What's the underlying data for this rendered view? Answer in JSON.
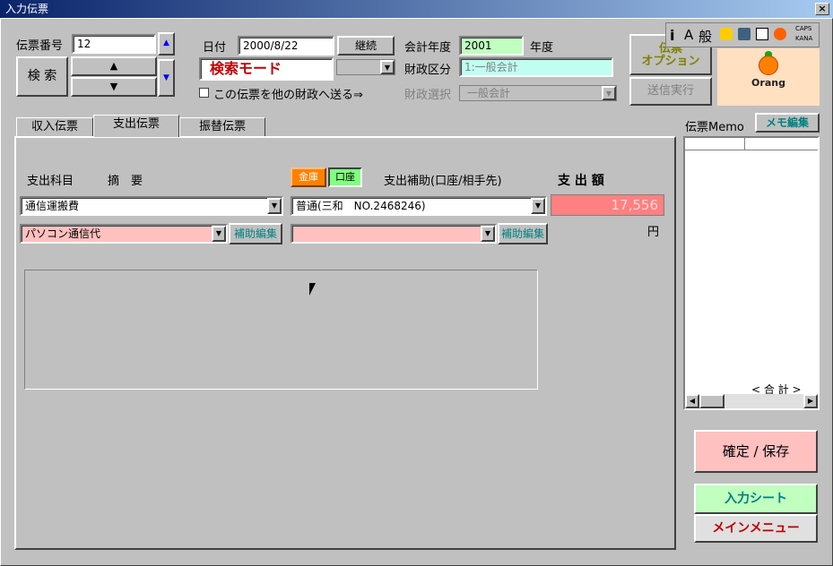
{
  "window": {
    "title": "入力伝票",
    "close": "×"
  },
  "voucher": {
    "number_label": "伝票番号",
    "number_value": "12",
    "search_button": "検 索",
    "up_arrow": "▲",
    "down_arrow": "▼"
  },
  "date": {
    "label": "日付",
    "value": "2000/8/22",
    "continue_button": "継続",
    "mode_text": "検索モード"
  },
  "send_other_finance": {
    "label": "この伝票を他の財政へ送る⇒"
  },
  "fiscal": {
    "year_label": "会計年度",
    "year_value": "2001",
    "year_suffix": "年度",
    "division_label": "財政区分",
    "division_value": "1:一般会計",
    "select_label": "財政選択",
    "select_value": "一般会計"
  },
  "actions": {
    "option_button": "伝票\nオプション",
    "send_button": "送信実行"
  },
  "toolbar": {
    "icon_text_i": "i",
    "icon_text_a": "A",
    "kanji": "般",
    "caps": "CAPS",
    "kana": "KANA"
  },
  "logo": {
    "text": "Orang"
  },
  "tabs": [
    {
      "label": "収入伝票"
    },
    {
      "label": "支出伝票"
    },
    {
      "label": "振替伝票"
    }
  ],
  "form": {
    "subject_label": "支出科目",
    "summary_label": "摘　要",
    "cash_button": "金庫",
    "account_button": "口座",
    "aux_label": "支出補助(口座/相手先)",
    "amount_label": "支 出 額",
    "subject_value": "通信運搬費",
    "account_value": "普通(三和　NO.2468246)",
    "amount_value": "17,556",
    "currency": "円",
    "summary_value": "パソコン通信代",
    "aux_value": "",
    "aux_edit_button_1": "補助編集",
    "aux_edit_button_2": "補助編集"
  },
  "memo": {
    "label": "伝票Memo",
    "edit_button": "メモ編集",
    "total_label": "< 合 計 >"
  },
  "bottom": {
    "confirm_button": "確定 / 保存",
    "input_sheet_button": "入力シート",
    "main_menu_button": "メインメニュー"
  },
  "colors": {
    "title_bar": "#0a246a",
    "amount_bg": "#ff8080",
    "pink_field": "#ffc0c0",
    "confirm_bg": "#ffc0c0",
    "input_sheet_bg": "#c0ffc0",
    "year_bg": "#c0ffc0",
    "division_bg": "#c0fff0"
  }
}
